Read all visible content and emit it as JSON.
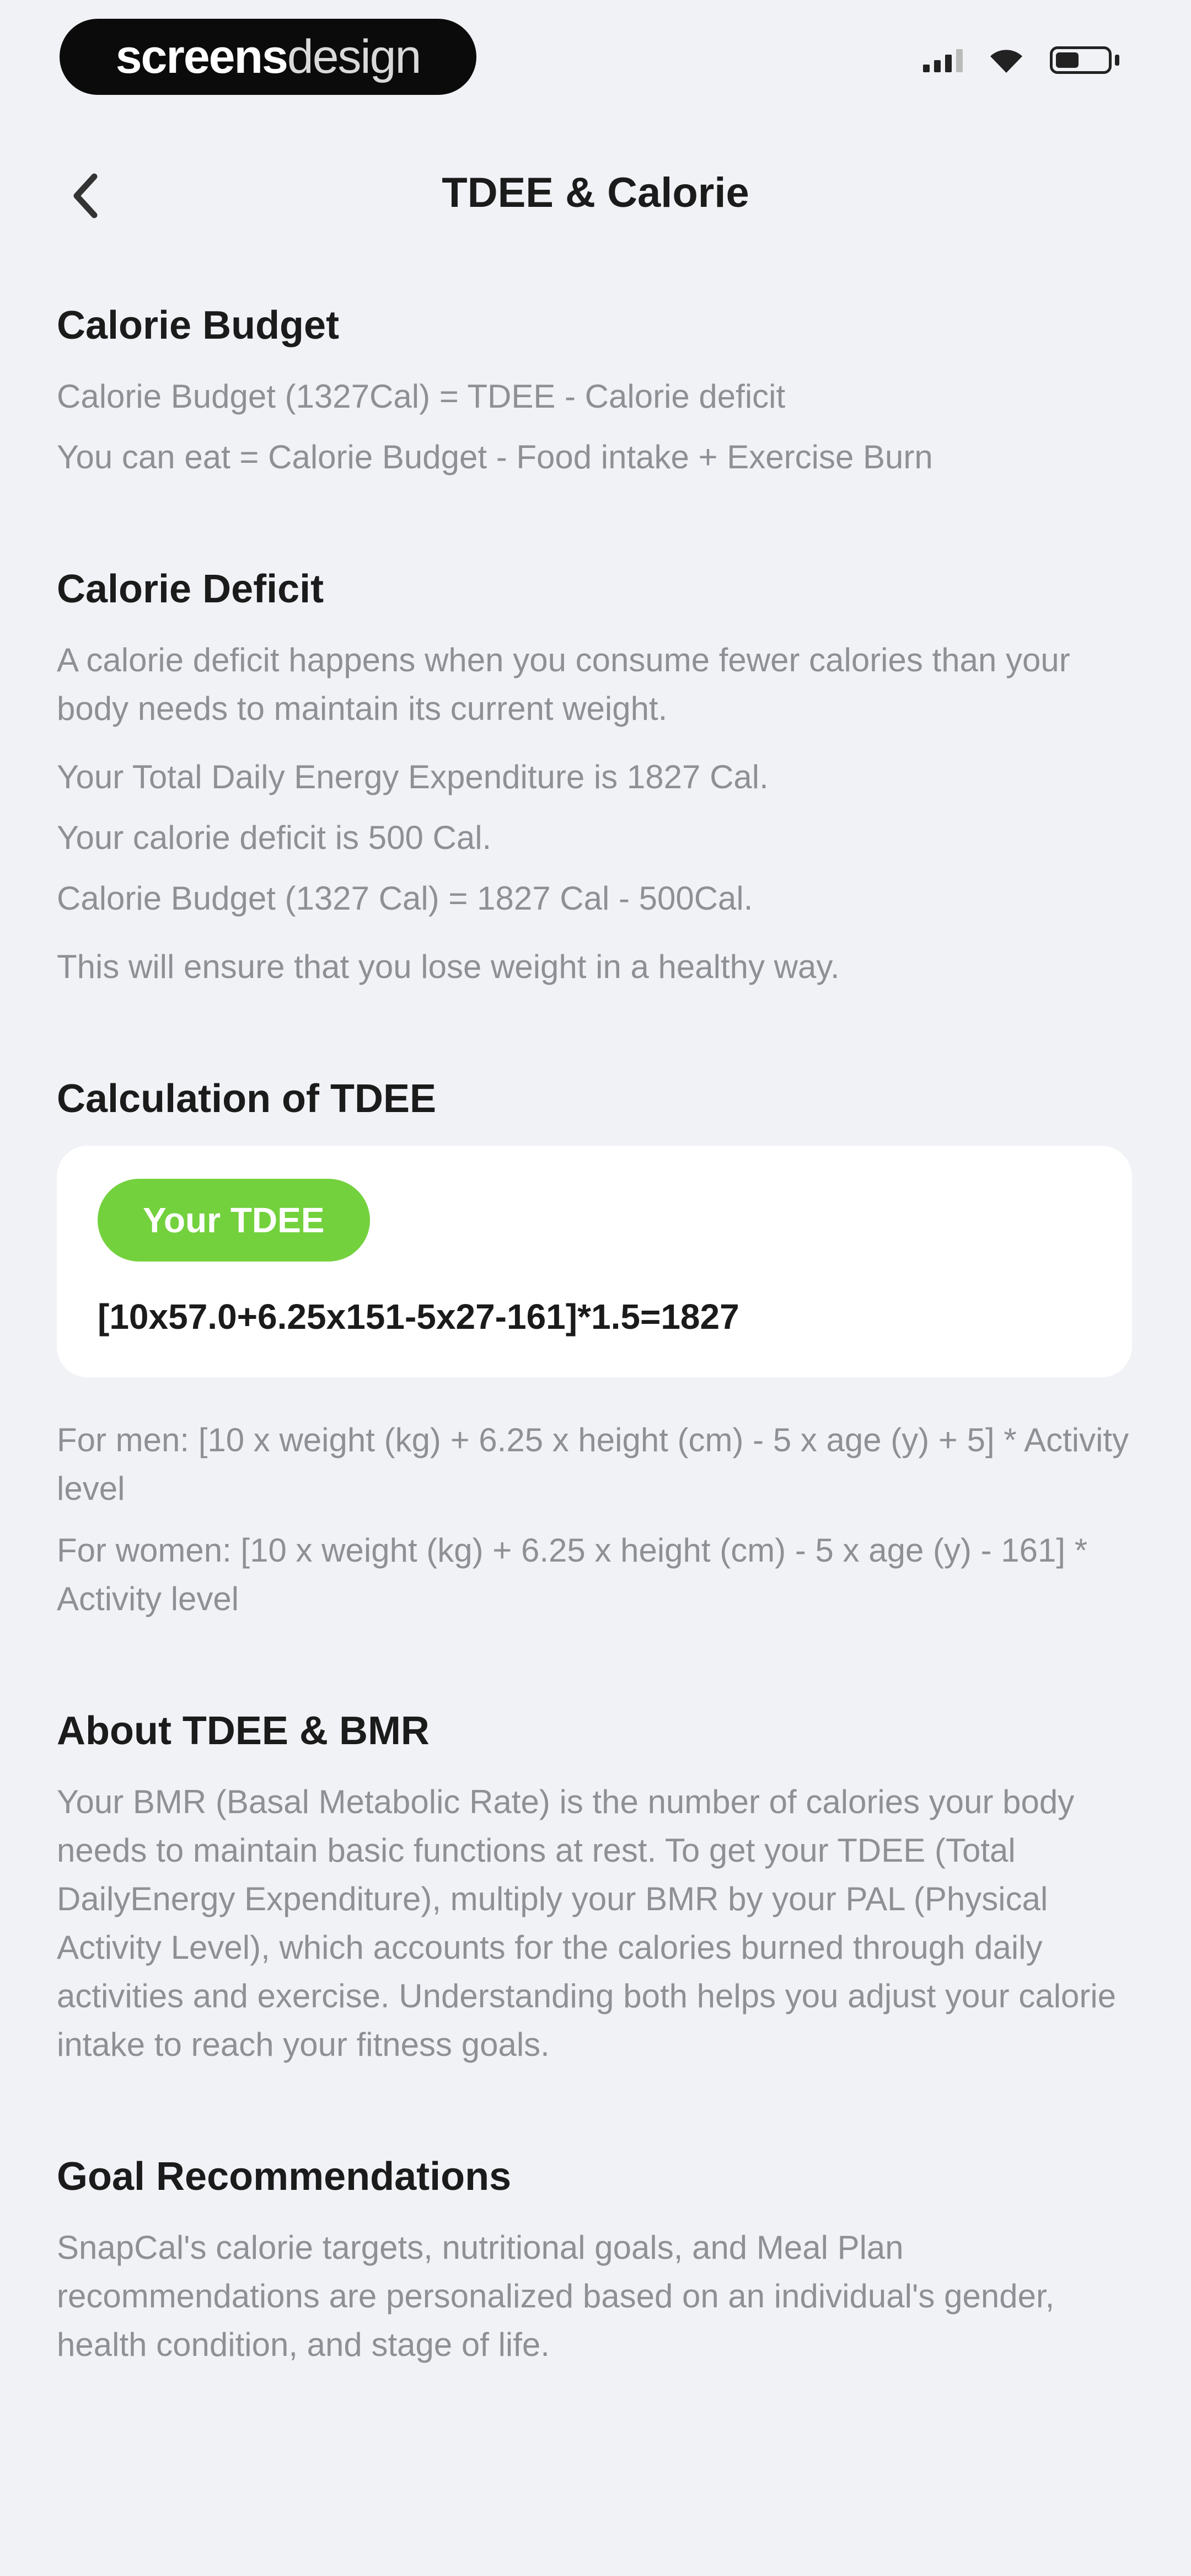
{
  "status_bar": {
    "brand_bold": "screens",
    "brand_light": "design",
    "icons": [
      "signal-icon",
      "wifi-icon",
      "battery-icon"
    ]
  },
  "nav": {
    "back_icon": "chevron-left-icon",
    "title": "TDEE & Calorie"
  },
  "budget": {
    "heading": "Calorie Budget",
    "line1": "Calorie Budget (1327Cal) = TDEE - Calorie deficit",
    "line2": "You can eat = Calorie Budget - Food intake + Exercise Burn"
  },
  "deficit": {
    "heading": "Calorie Deficit",
    "intro": "A calorie deficit happens when you consume fewer calories than your body needs to maintain its current weight.",
    "line1": "Your Total Daily Energy Expenditure is 1827 Cal.",
    "line2": "Your calorie deficit is 500 Cal.",
    "line3": "Calorie Budget (1327 Cal) = 1827 Cal - 500Cal.",
    "line4": "This will ensure that you lose weight in a healthy way."
  },
  "calculation": {
    "heading": "Calculation of TDEE",
    "pill_label": "Your TDEE",
    "formula": "[10x57.0+6.25x151-5x27-161]*1.5=1827",
    "men": "For men: [10 x weight (kg) + 6.25 x height (cm) - 5 x age (y) + 5] * Activity level",
    "women": "For women: [10 x weight (kg) + 6.25 x height (cm) - 5 x age (y) - 161] * Activity level"
  },
  "about": {
    "heading": "About TDEE & BMR",
    "body": "Your BMR (Basal Metabolic Rate) is the number of calories your body needs to maintain basic functions at rest. To get your TDEE (Total DailyEnergy Expenditure), multiply your BMR by your PAL (Physical Activity Level), which accounts for the calories burned through daily activities and exercise. Understanding both helps you adjust your calorie intake to reach your fitness goals."
  },
  "goal": {
    "heading": "Goal Recommendations",
    "body": "SnapCal's calorie targets, nutritional goals, and Meal Plan recommendations are personalized based on an individual's gender, health condition, and stage of life."
  },
  "colors": {
    "background": "#f0f2f6",
    "accent_green": "#73d13d",
    "card": "#ffffff",
    "muted_text": "#8e9095"
  }
}
